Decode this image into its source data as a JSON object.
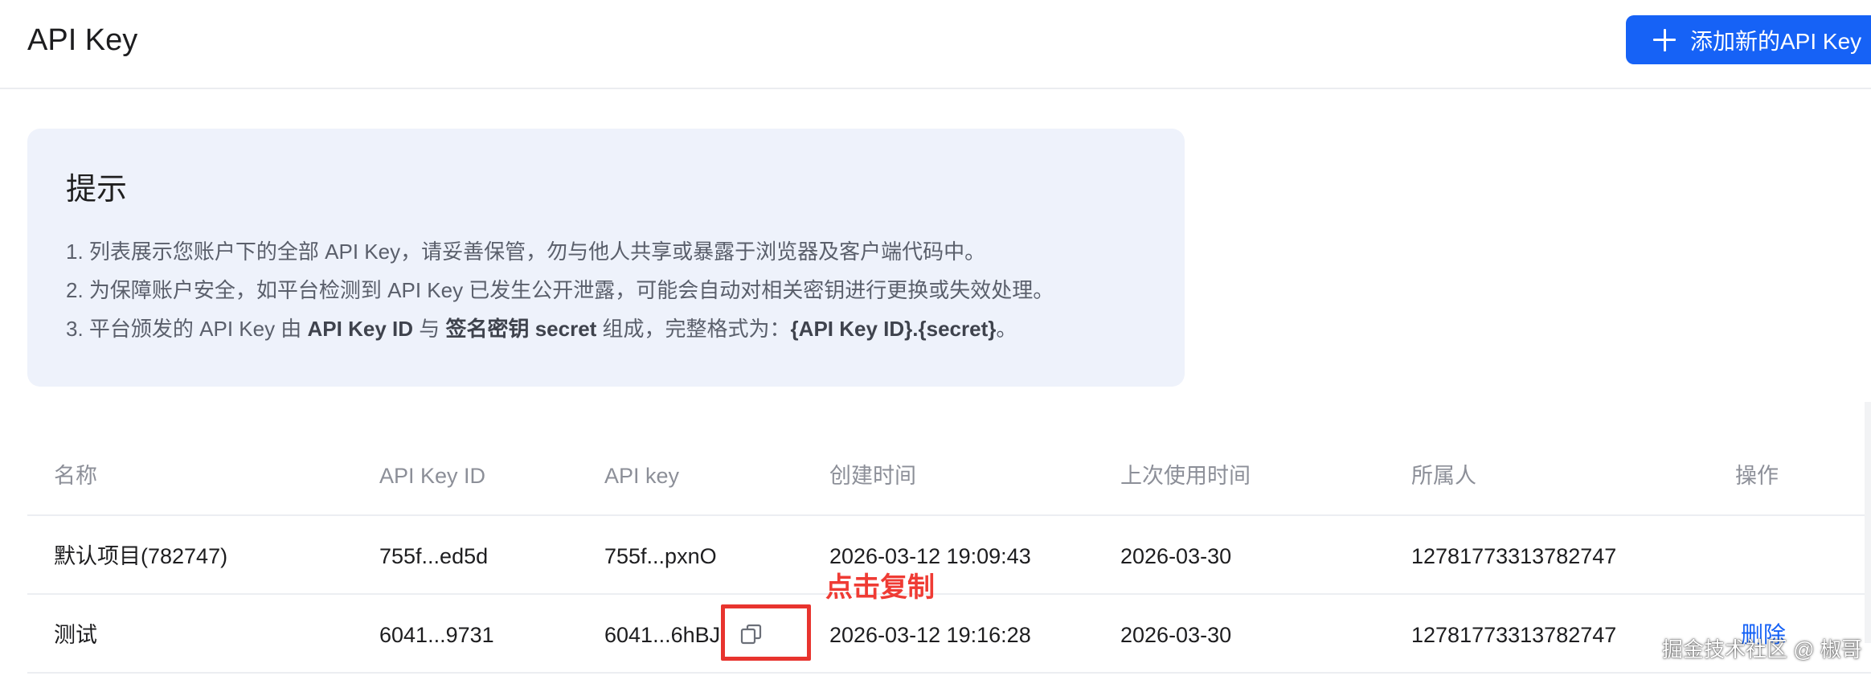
{
  "header": {
    "title": "API Key",
    "add_button_label": "添加新的API Key"
  },
  "tips": {
    "title": "提示",
    "line1": "1. 列表展示您账户下的全部 API Key，请妥善保管，勿与他人共享或暴露于浏览器及客户端代码中。",
    "line2": "2. 为保障账户安全，如平台检测到 API Key 已发生公开泄露，可能会自动对相关密钥进行更换或失效处理。",
    "line3": {
      "prefix": "3. 平台颁发的 API Key 由 ",
      "bold1": "API Key ID",
      "mid": " 与 ",
      "bold2": "签名密钥 secret",
      "suffix": " 组成，完整格式为：",
      "bold3": "{API Key ID}.{secret}",
      "end": "。"
    }
  },
  "table": {
    "columns": [
      "名称",
      "API Key ID",
      "API key",
      "创建时间",
      "上次使用时间",
      "所属人",
      "操作"
    ],
    "rows": [
      {
        "name": "默认项目(782747)",
        "api_key_id": "755f...ed5d",
        "api_key": "755f...pxnO",
        "created": "2026-03-12 19:09:43",
        "last_used": "2026-03-30",
        "owner": "12781773313782747",
        "action": ""
      },
      {
        "name": "测试",
        "api_key_id": "6041...9731",
        "api_key": "6041...6hBJ",
        "created": "2026-03-12 19:16:28",
        "last_used": "2026-03-30",
        "owner": "12781773313782747",
        "action": "删除"
      }
    ]
  },
  "annotation": {
    "text": "点击复制",
    "color": "#ef3b34"
  },
  "watermark": "掘金技术社区 @ 椒哥",
  "colors": {
    "primary": "#1662f6",
    "tip_background": "#eef2fb",
    "annotation_box": "#e8342e"
  },
  "icons": {
    "add": "plus-icon",
    "copy": "copy-icon"
  }
}
